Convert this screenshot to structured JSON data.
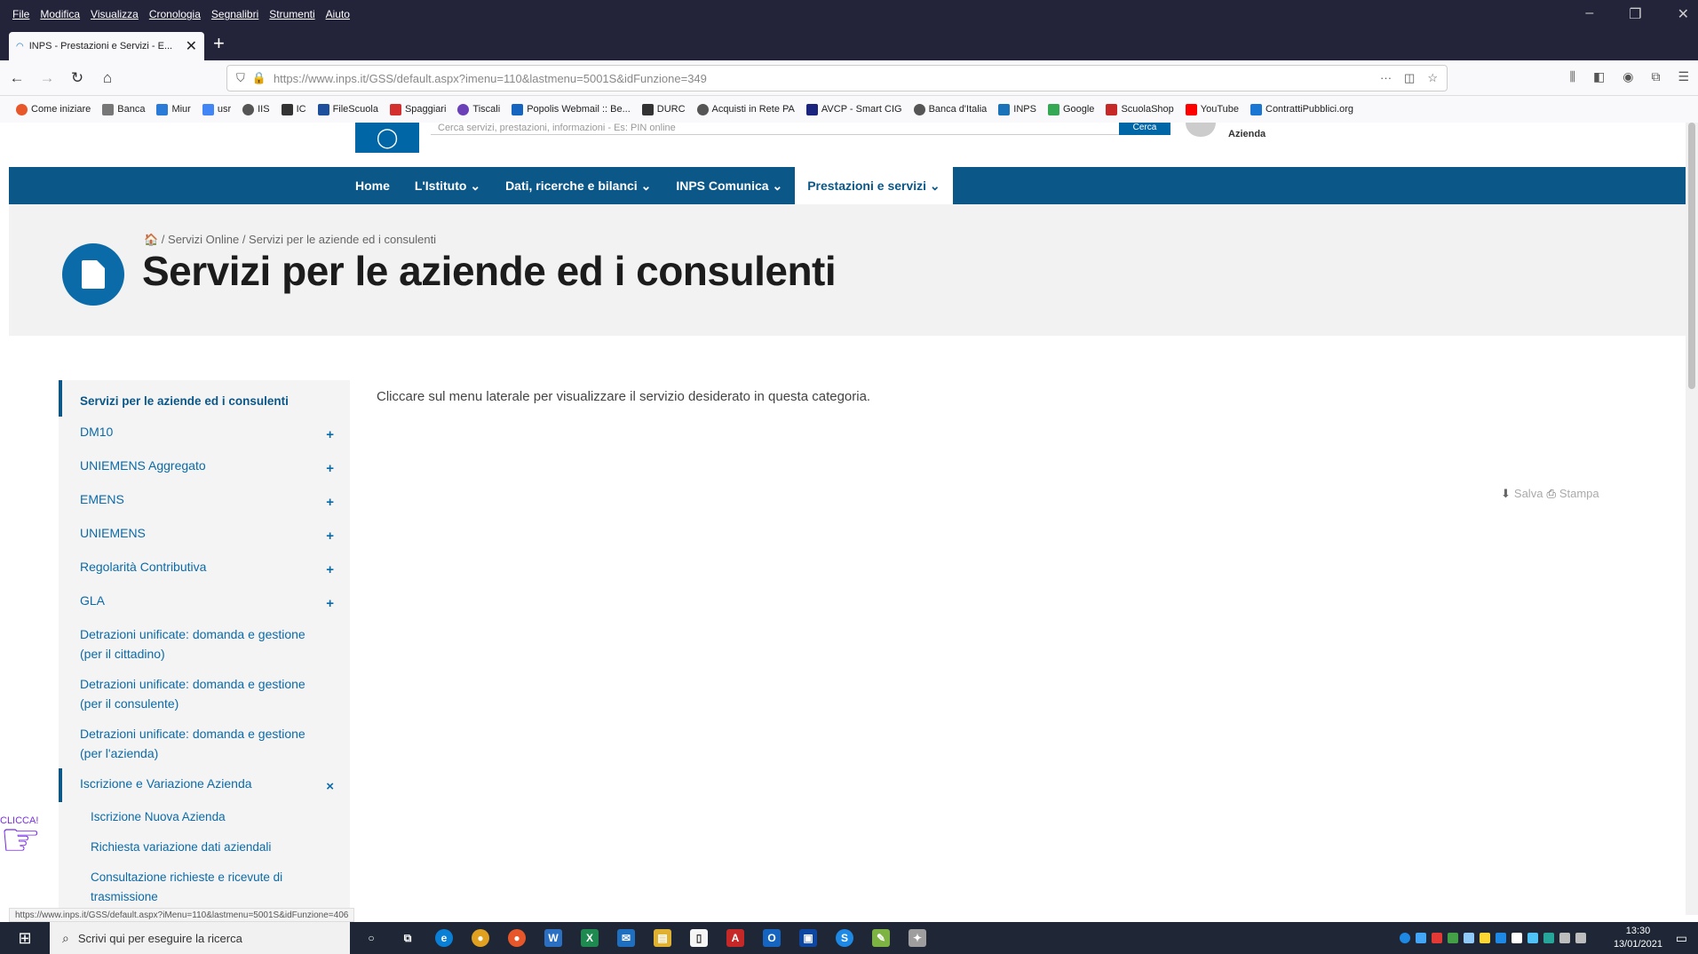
{
  "browser": {
    "menu": [
      "File",
      "Modifica",
      "Visualizza",
      "Cronologia",
      "Segnalibri",
      "Strumenti",
      "Aiuto"
    ],
    "window_controls": [
      "–",
      "❐",
      "✕"
    ],
    "tab_title": "INPS - Prestazioni e Servizi - E...",
    "tab_close": "✕",
    "new_tab": "+",
    "url": "https://www.inps.it/GSS/default.aspx?imenu=110&lastmenu=5001S&idFunzione=349",
    "bookmarks": [
      "Come iniziare",
      "Banca",
      "Miur",
      "usr",
      "IIS",
      "IC",
      "FileScuola",
      "Spaggiari",
      "Tiscali",
      "Popolis Webmail :: Be...",
      "DURC",
      "Acquisti in Rete PA",
      "AVCP - Smart CIG",
      "Banca d'Italia",
      "INPS",
      "Google",
      "ScuolaShop",
      "YouTube",
      "ContrattiPubblici.org"
    ],
    "status_url": "https://www.inps.it/GSS/default.aspx?iMenu=110&lastmenu=5001S&idFunzione=406"
  },
  "site": {
    "user_label": "Azienda",
    "search_placeholder": "Cerca servizi, prestazioni, informazioni - Es: PIN online",
    "search_button": "Cerca",
    "nav": [
      "Home",
      "L'Istituto ⌄",
      "Dati, ricerche e bilanci ⌄",
      "INPS Comunica ⌄",
      "Prestazioni e servizi ⌄"
    ],
    "breadcrumb": "🏠 / Servizi Online / Servizi per le aziende ed i consulenti",
    "page_title": "Servizi per le aziende ed i consulenti",
    "content_text": "Cliccare sul menu laterale per visualizzare il servizio desiderato in questa categoria.",
    "actions": {
      "save": "Salva",
      "print": "Stampa"
    }
  },
  "sidebar": {
    "header": "Servizi per le aziende ed i consulenti",
    "items": [
      {
        "label": "DM10",
        "toggle": "+"
      },
      {
        "label": "UNIEMENS Aggregato",
        "toggle": "+"
      },
      {
        "label": "EMENS",
        "toggle": "+"
      },
      {
        "label": "UNIEMENS",
        "toggle": "+"
      },
      {
        "label": "Regolarità Contributiva",
        "toggle": "+"
      },
      {
        "label": "GLA",
        "toggle": "+"
      },
      {
        "label": "Detrazioni unificate: domanda e gestione (per il cittadino)",
        "toggle": ""
      },
      {
        "label": "Detrazioni unificate: domanda e gestione (per il consulente)",
        "toggle": ""
      },
      {
        "label": "Detrazioni unificate: domanda e gestione (per l'azienda)",
        "toggle": ""
      },
      {
        "label": "Iscrizione e Variazione Azienda",
        "toggle": "×"
      }
    ],
    "subitems": [
      "Iscrizione Nuova Azienda",
      "Richiesta variazione dati aziendali",
      "Consultazione richieste e ricevute di trasmissione"
    ]
  },
  "overlay": {
    "clicca": "CLICCA!"
  },
  "taskbar": {
    "search_placeholder": "Scrivi qui per eseguire la ricerca",
    "time": "13:30",
    "date": "13/01/2021"
  },
  "colors": {
    "brand": "#0b5788",
    "link": "#0b6aa8",
    "hero_bg": "#f2f2f2"
  }
}
